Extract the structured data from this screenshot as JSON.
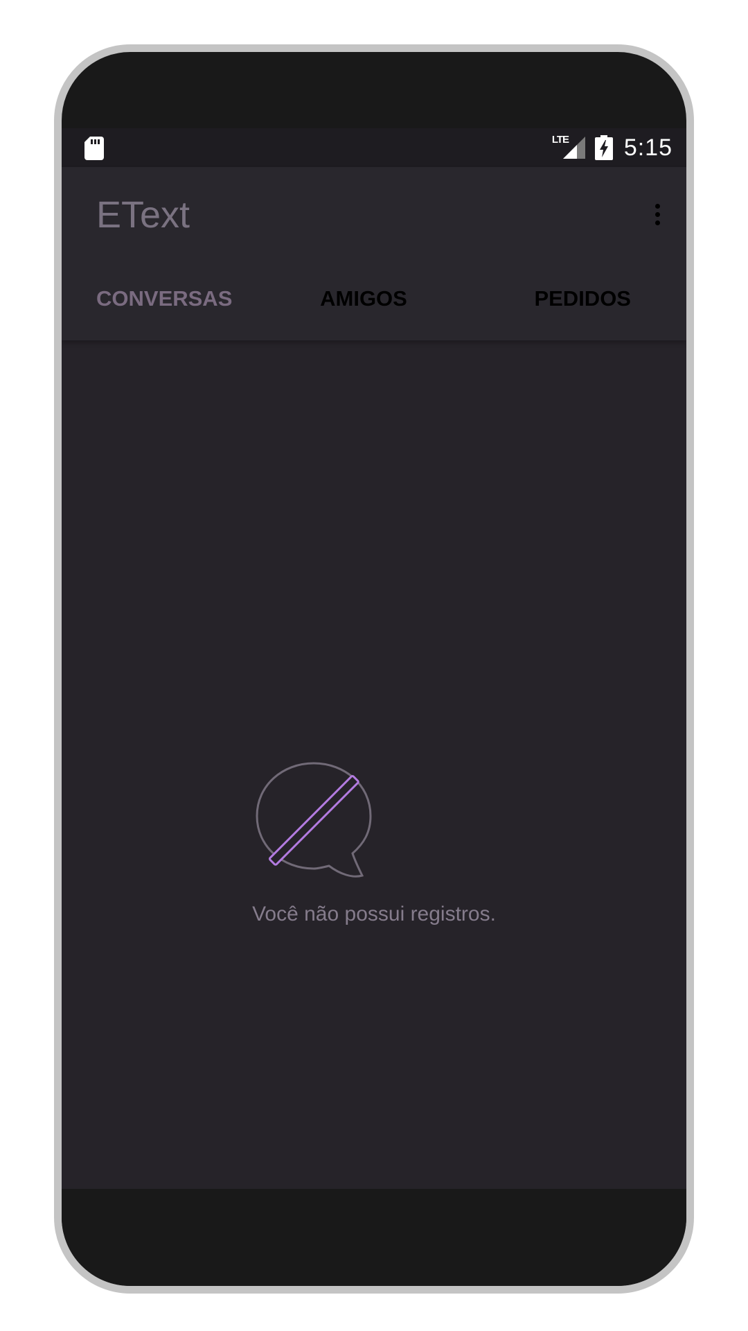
{
  "status_bar": {
    "time": "5:15",
    "network_label": "LTE",
    "icons": [
      "sd-card-icon",
      "lte-signal-icon",
      "battery-charging-icon"
    ]
  },
  "app_bar": {
    "title": "EText",
    "overflow_icon": "more-vert-icon"
  },
  "tabs": [
    {
      "label": "CONVERSAS",
      "active": true
    },
    {
      "label": "AMIGOS",
      "active": false
    },
    {
      "label": "PEDIDOS",
      "active": false
    }
  ],
  "empty_state": {
    "icon": "no-chat-icon",
    "message": "Você não possui registros."
  },
  "colors": {
    "background": "#262329",
    "app_bar": "#29272d",
    "status_bar": "#1e1c21",
    "title_text": "#7a7281",
    "active_tab": "#7a6b80",
    "inactive_tab": "#000000",
    "accent": "#b37be0",
    "empty_text": "#857c8c"
  }
}
